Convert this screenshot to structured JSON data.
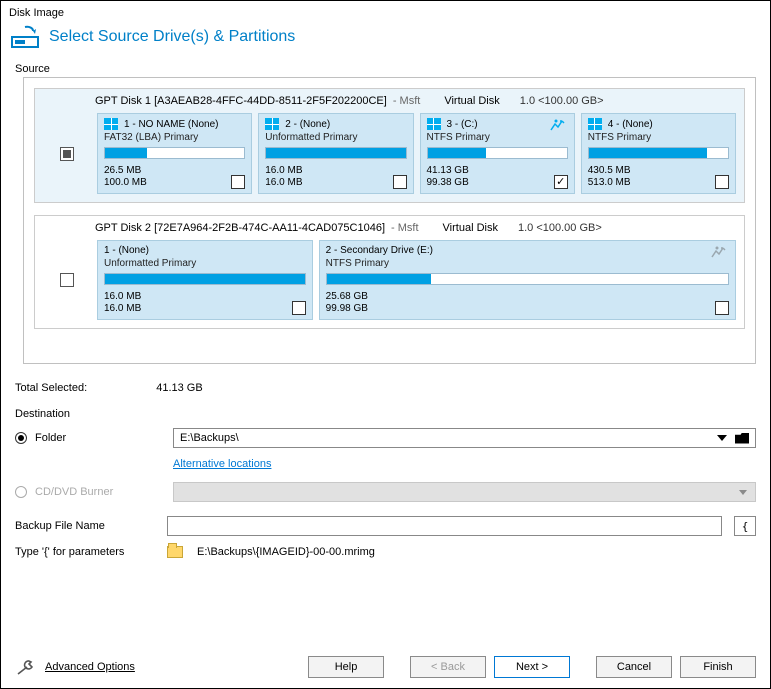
{
  "window": {
    "title": "Disk Image"
  },
  "header": {
    "title": "Select Source Drive(s) & Partitions"
  },
  "source": {
    "label": "Source",
    "disks": [
      {
        "label": "GPT Disk 1 [A3AEAB28-4FFC-44DD-8511-2F5F202200CE]",
        "msft": " - Msft",
        "virtual": "Virtual Disk",
        "lo": "1.0  <100.00 GB>",
        "chk_state": "indeterminate",
        "layout": "row4",
        "partitions": [
          {
            "title": "1 - NO NAME (None)",
            "sub": "FAT32 (LBA) Primary",
            "fill": 30,
            "used": "26.5 MB",
            "total": "100.0 MB",
            "checked": false,
            "has_runner": false,
            "has_flag": true
          },
          {
            "title": "2 - (None)",
            "sub": "Unformatted Primary",
            "fill": 100,
            "used": "16.0 MB",
            "total": "16.0 MB",
            "checked": false,
            "has_runner": false,
            "has_flag": true
          },
          {
            "title": "3 - (C:)",
            "sub": "NTFS Primary",
            "fill": 42,
            "used": "41.13 GB",
            "total": "99.38 GB",
            "checked": true,
            "has_runner": true,
            "has_flag": true
          },
          {
            "title": "4 - (None)",
            "sub": "NTFS Primary",
            "fill": 85,
            "used": "430.5 MB",
            "total": "513.0 MB",
            "checked": false,
            "has_runner": false,
            "has_flag": true
          }
        ]
      },
      {
        "label": "GPT Disk 2 [72E7A964-2F2B-474C-AA11-4CAD075C1046]",
        "msft": " - Msft",
        "virtual": "Virtual Disk",
        "lo": "1.0  <100.00 GB>",
        "chk_state": "none",
        "layout": "row2wide",
        "partitions": [
          {
            "title": "1 - (None)",
            "sub": "Unformatted Primary",
            "fill": 100,
            "used": "16.0 MB",
            "total": "16.0 MB",
            "checked": false,
            "has_runner": false,
            "has_flag": false
          },
          {
            "title": "2 - Secondary Drive (E:)",
            "sub": "NTFS Primary",
            "fill": 26,
            "used": "25.68 GB",
            "total": "99.98 GB",
            "checked": false,
            "has_runner": true,
            "has_flag": false
          }
        ]
      }
    ]
  },
  "total": {
    "label": "Total Selected:",
    "value": "41.13 GB"
  },
  "destination": {
    "label": "Destination",
    "folder_radio": "Folder",
    "folder_path": "E:\\Backups\\",
    "alt_link": "Alternative locations",
    "burner_radio": "CD/DVD Burner",
    "backup_name_label": "Backup File Name",
    "backup_name_value": "",
    "brace": "{",
    "type_hint_label": "Type '{' for parameters",
    "type_hint_path": "E:\\Backups\\{IMAGEID}-00-00.mrimg"
  },
  "footer": {
    "advanced": "Advanced Options",
    "help": "Help",
    "back": "< Back",
    "next": "Next >",
    "cancel": "Cancel",
    "finish": "Finish"
  }
}
